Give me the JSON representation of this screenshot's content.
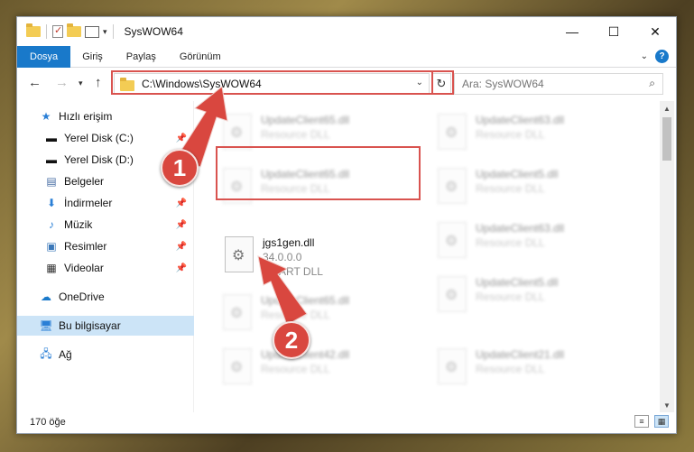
{
  "titlebar": {
    "title": "SysWOW64"
  },
  "ribbon": {
    "tabs": [
      "Dosya",
      "Giriş",
      "Paylaş",
      "Görünüm"
    ],
    "help": "?"
  },
  "address": {
    "path": "C:\\Windows\\SysWOW64"
  },
  "search": {
    "placeholder": "Ara: SysWOW64"
  },
  "sidebar": {
    "items": [
      {
        "label": "Hızlı erişim",
        "icon": "star-icon"
      },
      {
        "label": "Yerel Disk (C:)",
        "icon": "drive-icon"
      },
      {
        "label": "Yerel Disk (D:)",
        "icon": "drive-icon"
      },
      {
        "label": "Belgeler",
        "icon": "document-icon"
      },
      {
        "label": "İndirmeler",
        "icon": "download-icon"
      },
      {
        "label": "Müzik",
        "icon": "music-icon"
      },
      {
        "label": "Resimler",
        "icon": "picture-icon"
      },
      {
        "label": "Videolar",
        "icon": "video-icon"
      },
      {
        "label": "OneDrive",
        "icon": "cloud-icon"
      },
      {
        "label": "Bu bilgisayar",
        "icon": "computer-icon"
      },
      {
        "label": "Ağ",
        "icon": "network-icon"
      }
    ]
  },
  "files": [
    {
      "name": "UpdateClient65.dll",
      "sub": "Resource DLL"
    },
    {
      "name": "UpdateClient63.dll",
      "sub": "Resource DLL"
    },
    {
      "name": "UpdateClient65.dll",
      "sub": "Resource DLL"
    },
    {
      "name": "UpdateClient5.dll",
      "sub": "Resource DLL"
    },
    {
      "name": "jgs1gen.dll",
      "sub": "34.0.0.0",
      "sub2": "JG ART DLL"
    },
    {
      "name": "UpdateClient63.dll",
      "sub": "Resource DLL"
    },
    {
      "name": "UpdateClient65.dll",
      "sub": "Resource DLL"
    },
    {
      "name": "UpdateClient5.dll",
      "sub": "Resource DLL"
    },
    {
      "name": "UpdateClient42.dll",
      "sub": "Resource DLL"
    },
    {
      "name": "UpdateClient21.dll",
      "sub": "Resource DLL"
    }
  ],
  "status": {
    "count": "170 öğe"
  },
  "annotations": {
    "step1": "1",
    "step2": "2"
  },
  "colors": {
    "accent": "#1979ca",
    "highlight": "#d9534f",
    "selection": "#cce4f7"
  }
}
